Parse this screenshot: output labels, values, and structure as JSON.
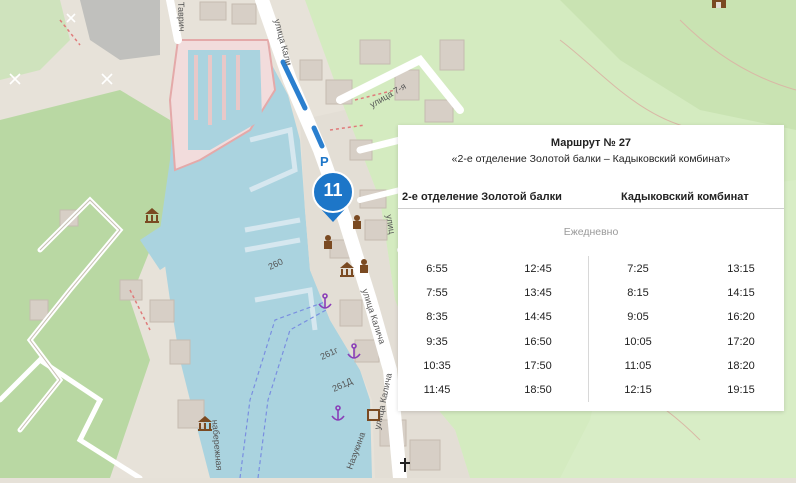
{
  "map": {
    "streets": [
      "улица Кали",
      "улица Калича",
      "улица Калича",
      "улица 7-я",
      "Наб",
      "набережная",
      "Назукина",
      "Таврич",
      "улиц"
    ],
    "bus_stop_number": "11",
    "parking_label": "P",
    "berth_labels": [
      "260",
      "261г",
      "261Д"
    ],
    "icons": [
      "museum-icon",
      "anchor-icon",
      "bank-icon",
      "church-icon",
      "cinema-icon",
      "mine-icon",
      "castle-icon"
    ]
  },
  "panel": {
    "title": "Маршрут № 27",
    "subtitle": "«2-е отделение Золотой балки – Кадыковский комбинат»",
    "left_header": "2-е отделение Золотой балки",
    "right_header": "Кадыковский комбинат",
    "frequency": "Ежедневно",
    "columns": [
      [
        "6:55",
        "7:55",
        "8:35",
        "9:35",
        "10:35",
        "11:45"
      ],
      [
        "12:45",
        "13:45",
        "14:45",
        "16:50",
        "17:50",
        "18:50"
      ],
      [
        "7:25",
        "8:15",
        "9:05",
        "10:05",
        "11:05",
        "12:15"
      ],
      [
        "13:15",
        "14:15",
        "16:20",
        "17:20",
        "18:20",
        "19:15"
      ]
    ]
  }
}
